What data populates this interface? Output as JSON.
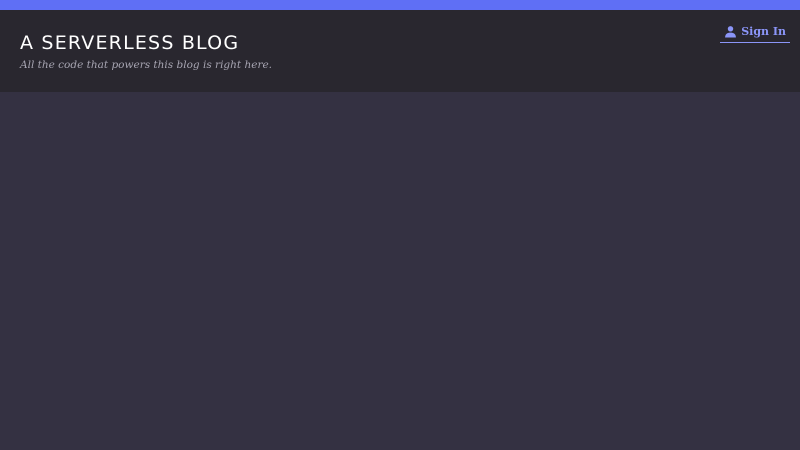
{
  "header": {
    "title": "A SERVERLESS BLOG",
    "tagline": "All the code that powers this blog is right here."
  },
  "auth": {
    "signin_label": "Sign In",
    "signin_icon": "person-icon"
  },
  "colors": {
    "accent": "#5f6ff5",
    "header_bg": "#29272f",
    "page_bg": "#343142",
    "link": "#8b95f8"
  }
}
